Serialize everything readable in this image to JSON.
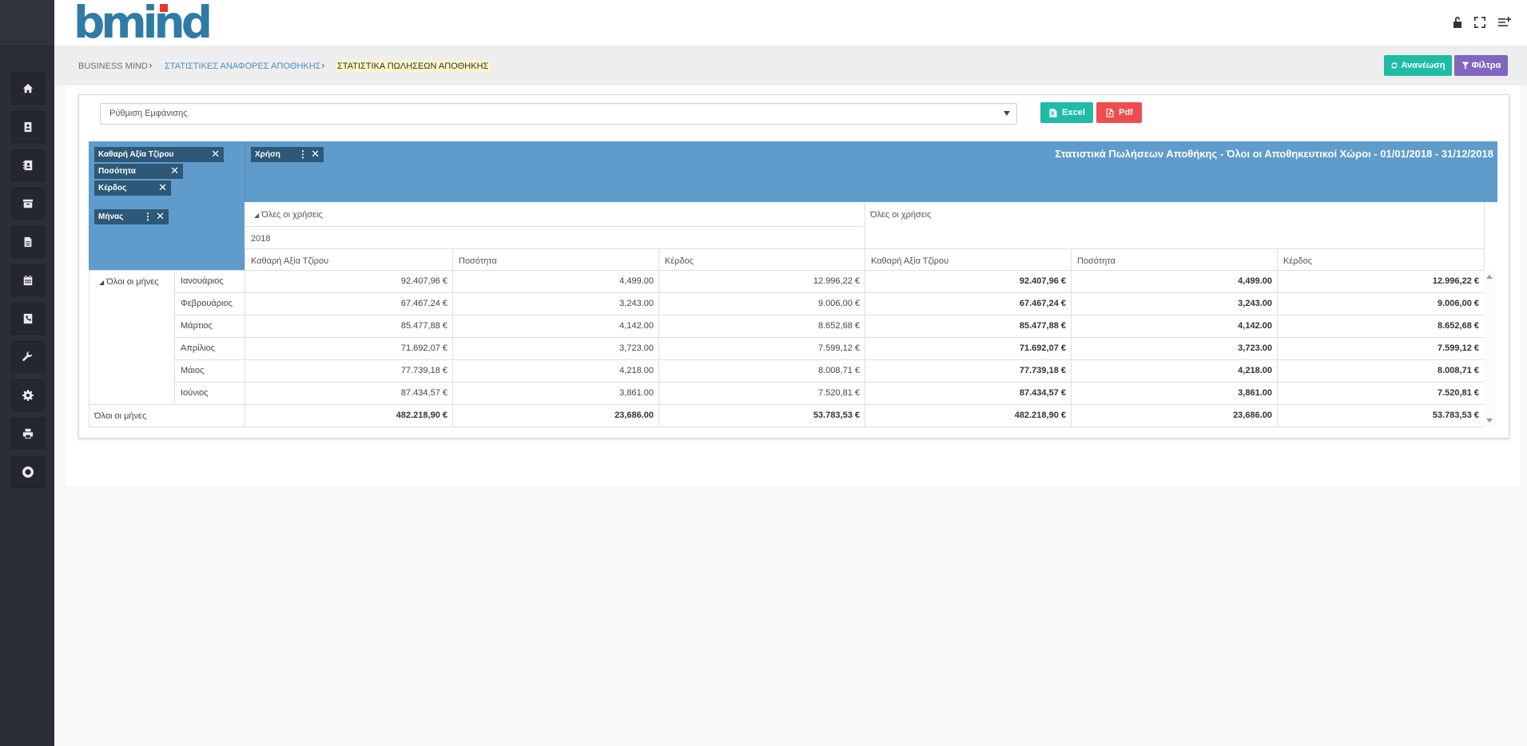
{
  "app": {
    "logo_text": "bmind"
  },
  "sidebar": {
    "items": [
      {
        "icon": "home-icon"
      },
      {
        "icon": "contacts-icon"
      },
      {
        "icon": "address-book-icon"
      },
      {
        "icon": "archive-icon"
      },
      {
        "icon": "document-icon"
      },
      {
        "icon": "calendar-icon"
      },
      {
        "icon": "phone-icon"
      },
      {
        "icon": "wrench-icon"
      },
      {
        "icon": "gear-icon"
      },
      {
        "icon": "printer-icon"
      },
      {
        "icon": "globe-icon"
      }
    ]
  },
  "header_icons": [
    "unlock-icon",
    "fullscreen-icon",
    "menu-add-icon"
  ],
  "breadcrumb": {
    "items": [
      "BUSINESS MIND",
      "ΣΤΑΤΙΣΤΙΚΕΣ ΑΝΑΦΟΡΕΣ ΑΠΟΘΗΚΗΣ",
      "ΣΤΑΤΙΣΤΙΚΑ ΠΩΛΗΣΕΩΝ ΑΠΟΘΗΚΗΣ"
    ],
    "separator": "›"
  },
  "actions": {
    "refresh_label": "Ανανέωση",
    "filters_label": "Φίλτρα"
  },
  "toolbar": {
    "display_select": "Ρύθμιση Εμφάνισης",
    "excel_label": "Excel",
    "pdf_label": "Pdf"
  },
  "pivot": {
    "title": "Στατιστικά Πωλήσεων Αποθήκης - Όλοι οι Αποθηκευτικοί Χώροι - 01/01/2018 - 31/12/2018",
    "data_fields": [
      "Καθαρή Αξία Τζίρου",
      "Ποσότητα",
      "Κέρδος"
    ],
    "column_field": "Χρήση",
    "row_field": "Μήνας",
    "col_group_label": "Όλες οι χρήσεις",
    "col_year": "2018",
    "col_total_label": "Όλες οι χρήσεις",
    "measure_headers": [
      "Καθαρή Αξία Τζίρου",
      "Ποσότητα",
      "Κέρδος",
      "Καθαρή Αξία Τζίρου",
      "Ποσότητα",
      "Κέρδος"
    ],
    "row_group_label": "Όλοι οι μήνες",
    "rows": [
      {
        "month": "Ιανουάριος",
        "values": [
          "92.407,96 €",
          "4,499.00",
          "12.996,22 €",
          "92.407,96 €",
          "4,499.00",
          "12.996,22 €"
        ]
      },
      {
        "month": "Φεβρουάριος",
        "values": [
          "67.467,24 €",
          "3,243.00",
          "9.006,00 €",
          "67.467,24 €",
          "3,243.00",
          "9.006,00 €"
        ]
      },
      {
        "month": "Μάρτιος",
        "values": [
          "85.477,88 €",
          "4,142.00",
          "8.652,68 €",
          "85.477,88 €",
          "4,142.00",
          "8.652,68 €"
        ]
      },
      {
        "month": "Απρίλιος",
        "values": [
          "71.692,07 €",
          "3,723.00",
          "7.599,12 €",
          "71.692,07 €",
          "3,723.00",
          "7.599,12 €"
        ]
      },
      {
        "month": "Μάιος",
        "values": [
          "77.739,18 €",
          "4,218.00",
          "8.008,71 €",
          "77.739,18 €",
          "4,218.00",
          "8.008,71 €"
        ]
      },
      {
        "month": "Ιούνιος",
        "values": [
          "87.434,57 €",
          "3,861.00",
          "7.520,81 €",
          "87.434,57 €",
          "3,861.00",
          "7.520,81 €"
        ]
      }
    ],
    "total_label": "Όλοι οι μήνες",
    "totals": [
      "482.218,90 €",
      "23,686.00",
      "53.783,53 €",
      "482.218,90 €",
      "23,686.00",
      "53.783,53 €"
    ]
  },
  "colors": {
    "header_blue": "#5f9ccb",
    "chip": "#2e5878",
    "teal": "#1fbba6",
    "purple": "#8166bf",
    "red": "#ef4d4d",
    "sidebar": "#2b2e38"
  }
}
